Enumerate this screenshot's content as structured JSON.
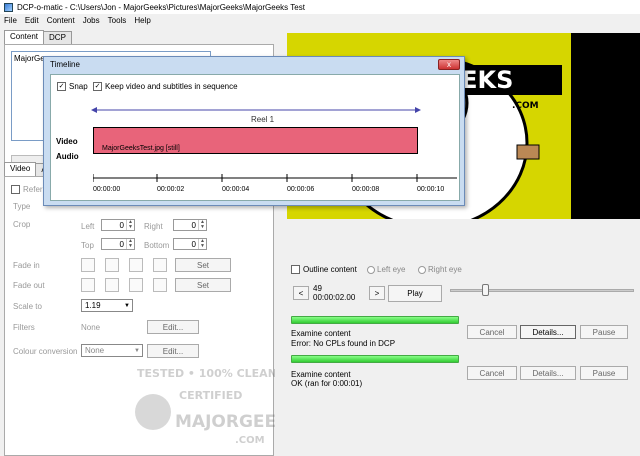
{
  "window": {
    "title": "DCP-o-matic - C:\\Users\\Jon - MajorGeeks\\Pictures\\MajorGeeks\\MajorGeeks Test"
  },
  "menu": [
    "File",
    "Edit",
    "Content",
    "Jobs",
    "Tools",
    "Help"
  ],
  "tabs": {
    "content": "Content",
    "dcp": "DCP"
  },
  "content_list": {
    "item": "MajorGe"
  },
  "settings_tabs": {
    "video": "Video",
    "audio": "Au"
  },
  "video": {
    "refer_label": "Refer",
    "type_label": "Type",
    "crop_label": "Crop",
    "left_label": "Left",
    "left_value": "0",
    "right_label": "Right",
    "right_value": "0",
    "top_label": "Top",
    "top_value": "0",
    "bottom_label": "Bottom",
    "bottom_value": "0",
    "fade_in_label": "Fade in",
    "fade_out_label": "Fade out",
    "set_label": "Set",
    "scale_label": "Scale to",
    "scale_value": "1.19",
    "filters_label": "Filters",
    "filters_value": "None",
    "edit_label": "Edit...",
    "colour_label": "Colour conversion",
    "colour_value": "None"
  },
  "timeline": {
    "title": "Timeline",
    "close": "x",
    "snap_label": "Snap",
    "sequence_label": "Keep video and subtitles in sequence",
    "reel_label": "Reel 1",
    "video_row": "Video",
    "audio_row": "Audio",
    "clip_label": "MajorGeeksTest.jpg [still]",
    "ticks": [
      "00:00:00",
      "00:00:02",
      "00:00:04",
      "00:00:06",
      "00:00:08",
      "00:00:10"
    ]
  },
  "player": {
    "outline_label": "Outline content",
    "left_eye": "Left eye",
    "right_eye": "Right eye",
    "frame": "49",
    "time": "00:00:02.00",
    "play": "Play",
    "prev": "<",
    "next": ">"
  },
  "jobs": [
    {
      "title": "Examine content",
      "status": "Error: No CPLs found in DCP",
      "cancel": "Cancel",
      "details": "Details...",
      "pause": "Pause"
    },
    {
      "title": "Examine content",
      "status": "OK (ran for 0:00:01)",
      "cancel": "Cancel",
      "details": "Details...",
      "pause": "Pause"
    }
  ],
  "logo": {
    "text": "GEEKS",
    "sub": ".COM"
  },
  "watermark": {
    "line1": "TESTED • 100% CLEAN",
    "line2": "CERTIFIED",
    "line3": "MAJORGEEKS",
    "line4": ".COM"
  },
  "colors": {
    "clip": "#e8647a",
    "progress": "#33cc33",
    "timeline_bg": "#c9dcf1"
  }
}
